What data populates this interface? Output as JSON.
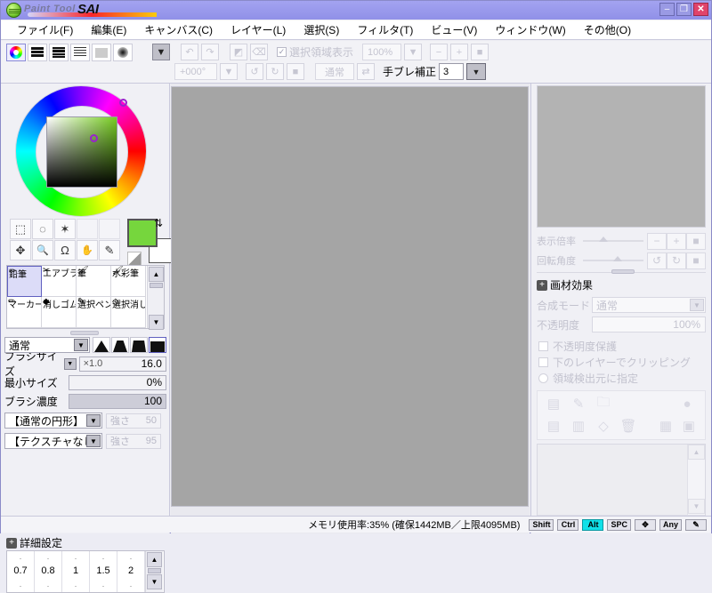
{
  "titlebar": {
    "logo_text": "Paint Tool",
    "logo_sai": "SAI",
    "minimize": "–",
    "maximize": "❐",
    "close": "✕"
  },
  "menu": [
    {
      "label": "ファイル(F)"
    },
    {
      "label": "編集(E)"
    },
    {
      "label": "キャンバス(C)"
    },
    {
      "label": "レイヤー(L)"
    },
    {
      "label": "選択(S)"
    },
    {
      "label": "フィルタ(T)"
    },
    {
      "label": "ビュー(V)"
    },
    {
      "label": "ウィンドウ(W)"
    },
    {
      "label": "その他(O)"
    }
  ],
  "toolbar": {
    "mode_icons": [
      "color-wheel",
      "rgb-sliders",
      "hsv-sliders",
      "color-list",
      "swatch-grid",
      "gradient-blob"
    ],
    "dropdown_arrow": "▼",
    "undo": "↶",
    "redo": "↷",
    "sel_invert": "◩",
    "sel_clear": "⌫",
    "selection_display_label": "選択領域表示",
    "selection_display_checked": true,
    "zoom_value": "100%",
    "zoom_out": "−",
    "zoom_in": "+",
    "zoom_reset": "■",
    "rotate_value": "+000°",
    "rotate_ccw": "↺",
    "rotate_cw": "↻",
    "rotate_reset": "■",
    "blend_label": "通常",
    "flip": "⇄",
    "stabilizer_label": "手ブレ補正",
    "stabilizer_value": "3"
  },
  "left_panel": {
    "color": {
      "foreground": "#76D63D",
      "background": "#FFFFFF",
      "swap_icon": "⇅",
      "wheel_marker_angle_deg": 72
    },
    "tools_row1": [
      {
        "name": "rect-select",
        "glyph": "⬚"
      },
      {
        "name": "lasso-select",
        "glyph": "◌"
      },
      {
        "name": "magic-wand",
        "glyph": "✶"
      },
      {
        "name": "blank-1",
        "glyph": ""
      },
      {
        "name": "blank-2",
        "glyph": ""
      }
    ],
    "tools_row2": [
      {
        "name": "move",
        "glyph": "✥"
      },
      {
        "name": "zoom",
        "glyph": "🔍"
      },
      {
        "name": "rotate",
        "glyph": "Ω"
      },
      {
        "name": "hand",
        "glyph": "✋"
      },
      {
        "name": "eyedropper",
        "glyph": "✎"
      }
    ],
    "brush_presets": [
      {
        "label": "鉛筆",
        "icon": "✏",
        "selected": true
      },
      {
        "label": "エアブラシ",
        "icon": "✂",
        "selected": false
      },
      {
        "label": "筆",
        "icon": "🖌",
        "selected": false
      },
      {
        "label": "水彩筆",
        "icon": "🖌",
        "selected": false
      },
      {
        "label": "マーカー",
        "icon": "✏",
        "selected": false
      },
      {
        "label": "消しゴム",
        "icon": "◆",
        "selected": false
      },
      {
        "label": "選択ペン",
        "icon": "✎",
        "selected": false
      },
      {
        "label": "選択消し",
        "icon": "◇",
        "selected": false
      }
    ],
    "scroll_up": "▲",
    "scroll_down": "▼",
    "blend_mode": "通常",
    "edge_shapes": [
      "soft-triangle",
      "medium-trapezoid",
      "hard-trapezoid",
      "square-hard"
    ],
    "edge_selected_index": 3,
    "brush_size_label": "ブラシサイズ",
    "brush_size_multiplier": "×1.0",
    "brush_size_value": "16.0",
    "min_size_label": "最小サイズ",
    "min_size_value": "0%",
    "density_label": "ブラシ濃度",
    "density_value": "100",
    "shape_preset": "【通常の円形】",
    "shape_strength_label": "強さ",
    "shape_strength_value": "50",
    "texture_preset": "【テクスチャなし】",
    "texture_strength_label": "強さ",
    "texture_strength_value": "95",
    "detail_header": "詳細設定",
    "detail_expand_icon": "+",
    "detail_values": [
      "0.7",
      "0.8",
      "1",
      "1.5",
      "2"
    ]
  },
  "right_panel": {
    "zoom_label": "表示倍率",
    "rotate_label": "回転角度",
    "nav_zoom_out": "−",
    "nav_zoom_in": "+",
    "nav_zoom_reset": "■",
    "nav_rot_ccw": "↺",
    "nav_rot_cw": "↻",
    "nav_rot_reset": "■",
    "effect_header": "画材効果",
    "effect_expand_icon": "+",
    "blend_mode_label": "合成モード",
    "blend_mode_value": "通常",
    "opacity_label": "不透明度",
    "opacity_value": "100%",
    "lock_opacity_label": "不透明度保護",
    "clipping_label": "下のレイヤーでクリッピング",
    "region_source_label": "領域検出元に指定",
    "layer_buttons": [
      {
        "name": "new-layer",
        "glyph": "▤"
      },
      {
        "name": "new-linework-layer",
        "glyph": "✎"
      },
      {
        "name": "new-folder",
        "glyph": "🗀"
      },
      {
        "name": "layer-mask",
        "glyph": "●"
      },
      {
        "name": "merge-down",
        "glyph": "▤"
      },
      {
        "name": "merge-selected",
        "glyph": "▥"
      },
      {
        "name": "clear-layer",
        "glyph": "◇"
      },
      {
        "name": "delete-layer",
        "glyph": "🗑"
      },
      {
        "name": "duplicate-select",
        "glyph": "▦"
      },
      {
        "name": "duplicate-layer",
        "glyph": "▣"
      }
    ],
    "list_scroll_up": "▲",
    "list_scroll_down": "▼",
    "list_scroll_left": "◀",
    "list_scroll_right": "▶"
  },
  "status": {
    "memory_text": "メモリ使用率:35% (確保1442MB／上限4095MB)",
    "keys": [
      {
        "label": "Shift",
        "active": false
      },
      {
        "label": "Ctrl",
        "active": false
      },
      {
        "label": "Alt",
        "active": true
      },
      {
        "label": "SPC",
        "active": false
      },
      {
        "label": "✥",
        "active": false
      },
      {
        "label": "Any",
        "active": false
      },
      {
        "label": "✎",
        "active": false
      }
    ]
  }
}
